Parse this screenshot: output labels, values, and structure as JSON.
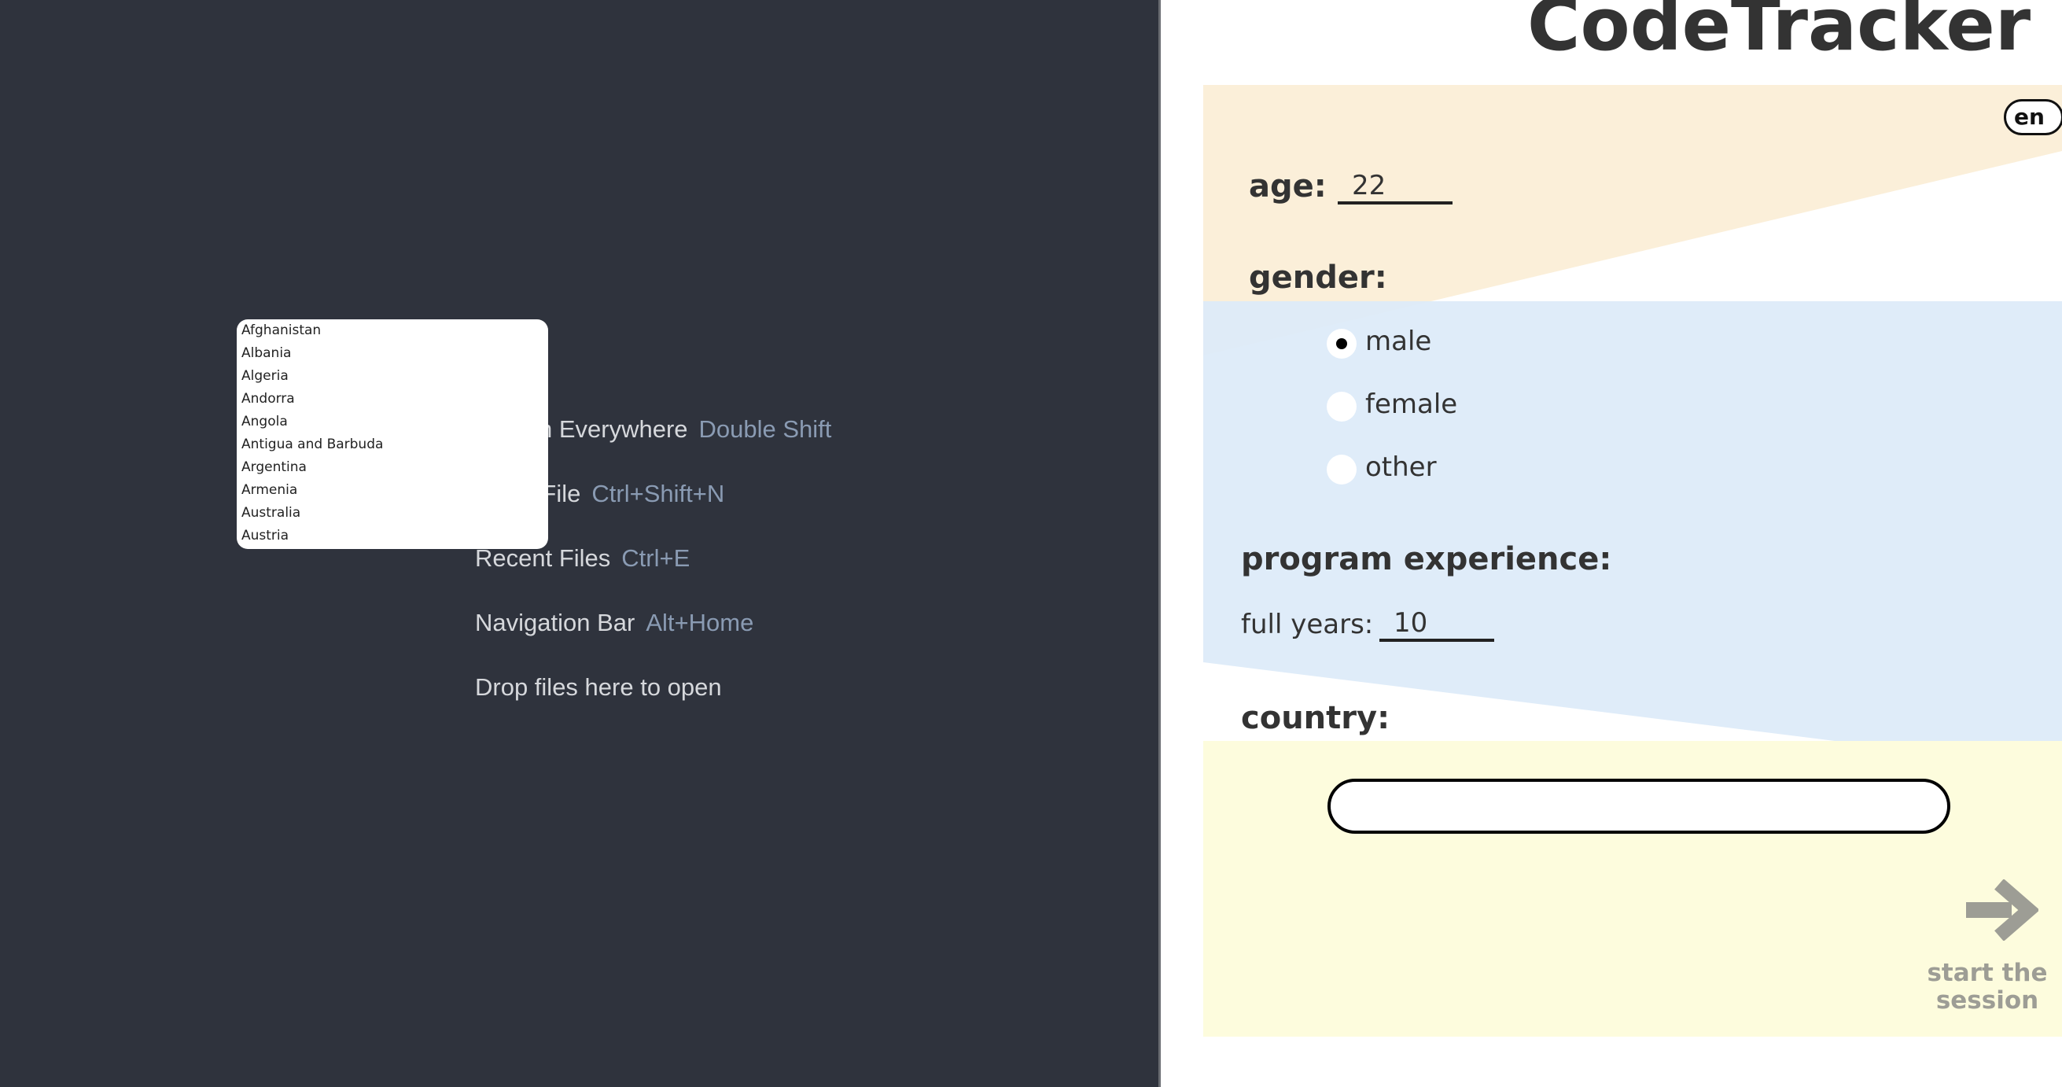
{
  "ide": {
    "hints": [
      {
        "label": "Search Everywhere",
        "shortcut": "Double Shift"
      },
      {
        "label": "Go to File",
        "shortcut": "Ctrl+Shift+N"
      },
      {
        "label": "Recent Files",
        "shortcut": "Ctrl+E"
      },
      {
        "label": "Navigation Bar",
        "shortcut": "Alt+Home"
      },
      {
        "label": "Drop files here to open",
        "shortcut": ""
      }
    ]
  },
  "country_dropdown": {
    "options": [
      "Afghanistan",
      "Albania",
      "Algeria",
      "Andorra",
      "Angola",
      "Antigua and Barbuda",
      "Argentina",
      "Armenia",
      "Australia",
      "Austria"
    ]
  },
  "form": {
    "title": "CodeTracker",
    "language": "en",
    "age_label": "age:",
    "age_value": "22",
    "gender_label": "gender:",
    "gender_options": [
      "male",
      "female",
      "other"
    ],
    "gender_selected": "male",
    "experience_label": "program experience:",
    "years_label": "full years:",
    "years_value": "10",
    "country_label": "country:",
    "country_value": "",
    "start_label_1": "start the",
    "start_label_2": "session"
  },
  "colors": {
    "ide_bg": "#2f333d",
    "peach": "#fbefd9",
    "blue": "#ddebf9",
    "yellow": "#fdfcdd",
    "arrow": "#9d9d95"
  }
}
